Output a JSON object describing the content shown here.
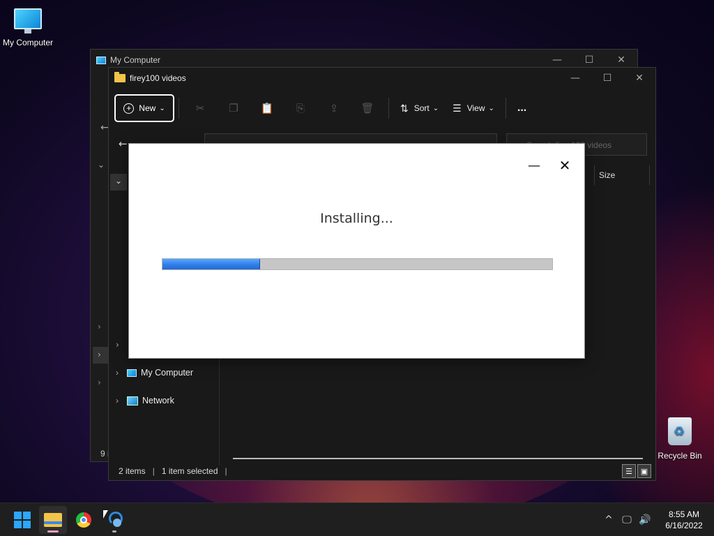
{
  "desktop": {
    "icons": [
      {
        "label": "My Computer",
        "icon": "monitor-icon"
      },
      {
        "label": "Recycle Bin",
        "icon": "recycle-bin-icon"
      }
    ]
  },
  "back_window": {
    "title": "My Computer",
    "status": "9 i"
  },
  "explorer": {
    "title": "firey100 videos",
    "toolbar": {
      "new_label": "New",
      "sort_label": "Sort",
      "view_label": "View",
      "more_label": "..."
    },
    "search_placeholder": "Search firey100 videos",
    "column_size": "Size",
    "nav": {
      "my_computer": "My Computer",
      "network": "Network"
    },
    "status": {
      "items": "2 items",
      "selected": "1 item selected"
    }
  },
  "installer": {
    "message": "Installing...",
    "progress_percent": 25
  },
  "taskbar": {
    "time": "8:55 AM",
    "date": "6/16/2022"
  },
  "colors": {
    "accent": "#2f7fe8",
    "taskbar": "#1f1f1f"
  }
}
